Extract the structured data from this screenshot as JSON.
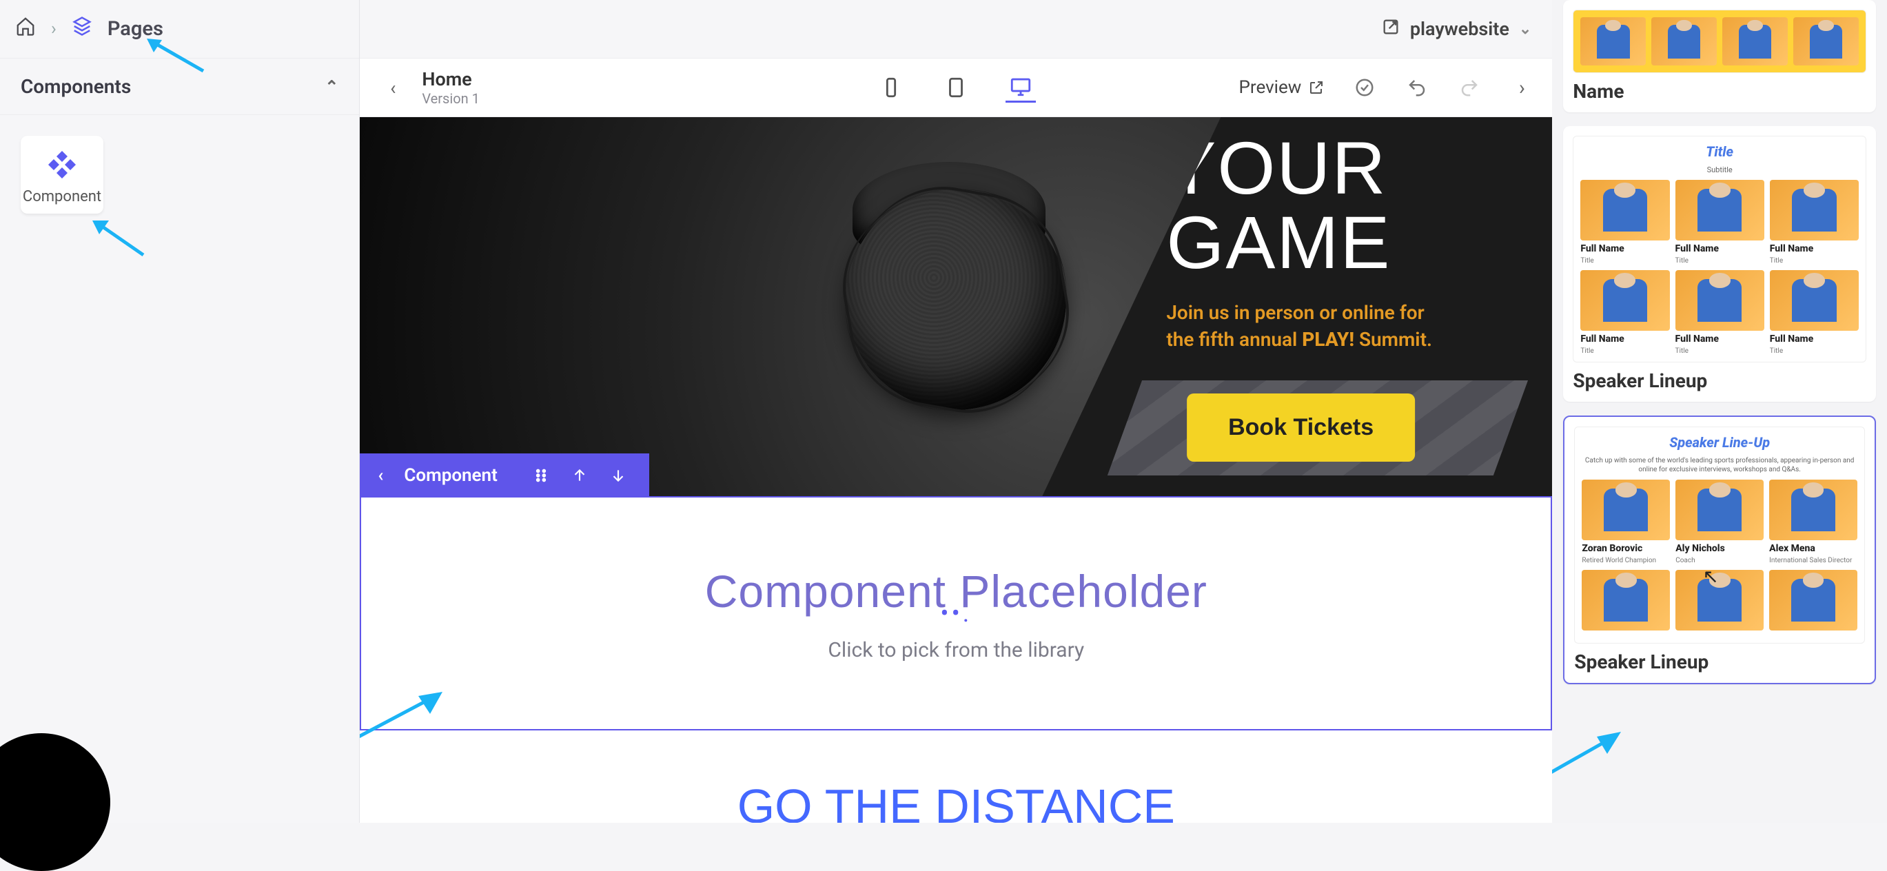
{
  "breadcrumb": {
    "pages_label": "Pages"
  },
  "sidebar": {
    "title": "Components",
    "tile": {
      "label": "Component"
    }
  },
  "projectbar": {
    "project_name": "playwebsite"
  },
  "editor": {
    "page_name": "Home",
    "page_version": "Version 1",
    "preview_label": "Preview"
  },
  "hero": {
    "headline_line1": "YOUR",
    "headline_line2": "GAME",
    "sub_pre": "Join us in person or online for the fifth annual ",
    "sub_bold": "PLAY!",
    "sub_post": " Summit.",
    "cta": "Book Tickets"
  },
  "comp_toolbar": {
    "label": "Component"
  },
  "placeholder": {
    "title": "Component Placeholder",
    "subtitle": "Click to pick from the library"
  },
  "go_distance": "GO THE DISTANCE",
  "right": {
    "card1": {
      "title": "Name"
    },
    "card2": {
      "title": "Speaker Lineup",
      "thumb_title": "Title",
      "thumb_subtitle": "Subtitle",
      "cells": [
        {
          "name": "Full Name",
          "sub": "Title"
        },
        {
          "name": "Full Name",
          "sub": "Title"
        },
        {
          "name": "Full Name",
          "sub": "Title"
        },
        {
          "name": "Full Name",
          "sub": "Title"
        },
        {
          "name": "Full Name",
          "sub": "Title"
        },
        {
          "name": "Full Name",
          "sub": "Title"
        }
      ]
    },
    "card3": {
      "title": "Speaker Lineup",
      "thumb_title": "Speaker Line-Up",
      "thumb_subtitle": "Catch up with some of the world's leading sports professionals, appearing in-person and online for exclusive interviews, workshops and Q&As.",
      "cells": [
        {
          "name": "Zoran Borovic",
          "sub": "Retired World Champion"
        },
        {
          "name": "Aly Nichols",
          "sub": "Coach"
        },
        {
          "name": "Alex Mena",
          "sub": "International Sales Director"
        },
        {
          "name": "",
          "sub": ""
        },
        {
          "name": "",
          "sub": ""
        },
        {
          "name": "",
          "sub": ""
        }
      ]
    }
  }
}
